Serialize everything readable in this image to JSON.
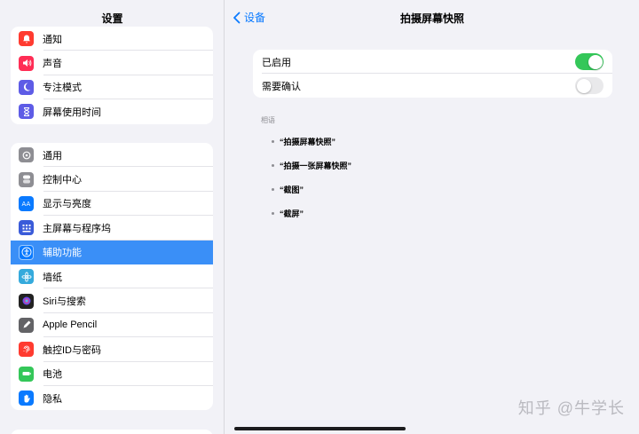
{
  "sidebar": {
    "title": "设置",
    "group1": [
      {
        "label": "通知",
        "icon": "bell-icon",
        "color": "#ff3b30"
      },
      {
        "label": "声音",
        "icon": "speaker-icon",
        "color": "#ff2d55"
      },
      {
        "label": "专注模式",
        "icon": "moon-icon",
        "color": "#5e5ce6"
      },
      {
        "label": "屏幕使用时间",
        "icon": "hourglass-icon",
        "color": "#5e5ce6"
      }
    ],
    "group2": [
      {
        "label": "通用",
        "icon": "gear-icon",
        "color": "#8e8e93"
      },
      {
        "label": "控制中心",
        "icon": "toggles-icon",
        "color": "#8e8e93"
      },
      {
        "label": "显示与亮度",
        "icon": "text-size-icon",
        "color": "#0a7aff"
      },
      {
        "label": "主屏幕与程序坞",
        "icon": "grid-icon",
        "color": "#3a5bd9"
      },
      {
        "label": "辅助功能",
        "icon": "accessibility-icon",
        "color": "#0a7aff"
      },
      {
        "label": "墙纸",
        "icon": "flower-icon",
        "color": "#35aadc"
      },
      {
        "label": "Siri与搜索",
        "icon": "siri-icon",
        "color": "#222"
      },
      {
        "label": "Apple Pencil",
        "icon": "pencil-icon",
        "color": "#636366"
      },
      {
        "label": "触控ID与密码",
        "icon": "fingerprint-icon",
        "color": "#ff3b30"
      },
      {
        "label": "电池",
        "icon": "battery-icon",
        "color": "#34c759"
      },
      {
        "label": "隐私",
        "icon": "hand-icon",
        "color": "#0a7aff"
      }
    ],
    "selected": "辅助功能"
  },
  "main": {
    "back_label": "设备",
    "title": "拍摄屏幕快照",
    "enabled_label": "已启用",
    "enabled": true,
    "confirm_label": "需要确认",
    "confirm": false,
    "say_label": "相语",
    "phrases": [
      "“拍摄屏幕快照”",
      "“拍摄一张屏幕快照”",
      "“截图”",
      "“截屏”"
    ]
  },
  "watermark": "知乎 @牛学长"
}
